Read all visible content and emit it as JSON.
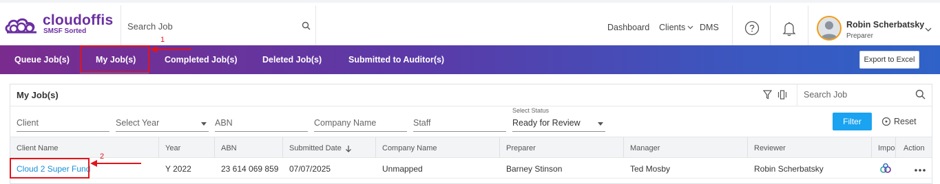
{
  "brand": {
    "name": "cloudoffis",
    "tagline": "SMSF Sorted",
    "color": "#6b2fa0"
  },
  "top_search": {
    "placeholder": "Search Job"
  },
  "nav": {
    "dashboard": "Dashboard",
    "clients": "Clients",
    "dms": "DMS"
  },
  "user": {
    "name": "Robin Scherbatsky",
    "role": "Preparer"
  },
  "tabs": [
    {
      "label": "Queue Job(s)"
    },
    {
      "label": "My Job(s)",
      "active": true
    },
    {
      "label": "Completed Job(s)"
    },
    {
      "label": "Deleted Job(s)"
    },
    {
      "label": "Submitted to Auditor(s)"
    }
  ],
  "export_label": "Export to Excel",
  "panel": {
    "title": "My Job(s)",
    "search_placeholder": "Search Job"
  },
  "filters": {
    "client": "Client",
    "year": "Select Year",
    "abn": "ABN",
    "company": "Company Name",
    "staff": "Staff",
    "status_label": "Select Status",
    "status_value": "Ready for Review",
    "filter_button": "Filter",
    "reset_button": "Reset"
  },
  "table": {
    "columns": [
      "Client Name",
      "Year",
      "ABN",
      "Submitted Date",
      "Company Name",
      "Preparer",
      "Manager",
      "Reviewer",
      "Impo",
      "Action"
    ],
    "rows": [
      {
        "client_name": "Cloud 2 Super Fund",
        "year": "Y 2022",
        "abn": "23 614 069 859",
        "submitted_date": "07/07/2025",
        "company_name": "Unmapped",
        "preparer": "Barney Stinson",
        "manager": "Ted Mosby",
        "reviewer": "Robin Scherbatsky"
      }
    ]
  },
  "annotations": {
    "one": "1",
    "two": "2"
  },
  "colors": {
    "accent": "#1aa3f0",
    "annotation": "#e0151b",
    "link": "#1a8fd6"
  }
}
